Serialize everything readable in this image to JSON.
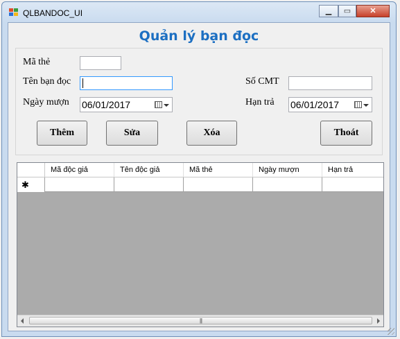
{
  "window": {
    "title": "QLBANDOC_UI",
    "controls": [
      "minimize-icon",
      "maximize-icon",
      "close-icon"
    ]
  },
  "form": {
    "heading": "Quản lý bạn đọc",
    "labels": {
      "ma_the": "Mã thẻ",
      "ten_ban_doc": "Tên bạn đọc",
      "ngay_muon": "Ngày mượn",
      "so_cmt": "Số CMT",
      "han_tra": "Hạn trả"
    },
    "values": {
      "ma_the": "",
      "ten_ban_doc": "",
      "so_cmt": "",
      "ngay_muon": "06/01/2017",
      "han_tra": "06/01/2017"
    },
    "buttons": {
      "them": "Thêm",
      "sua": "Sửa",
      "xoa": "Xóa",
      "thoat": "Thoát"
    }
  },
  "grid": {
    "columns": [
      "Mã độc giả",
      "Tên độc giả",
      "Mã thẻ",
      "Ngày mượn",
      "Hạn trả"
    ],
    "new_row_marker": "✱",
    "rows": []
  },
  "colors": {
    "heading": "#1c6fc2",
    "grid_background": "#ababab"
  }
}
